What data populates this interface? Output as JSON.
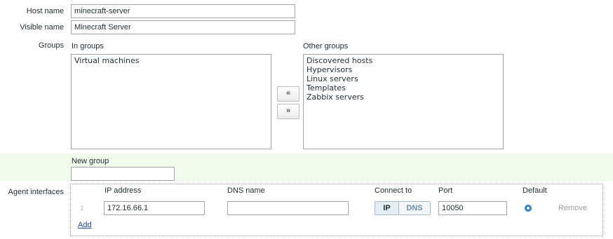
{
  "host": {
    "label": "Host name",
    "value": "minecraft-server"
  },
  "visible": {
    "label": "Visible name",
    "value": "Minecraft Server"
  },
  "groups": {
    "label": "Groups",
    "in_groups_label": "In groups",
    "other_groups_label": "Other groups",
    "in_groups": [
      "Virtual machines"
    ],
    "other_groups": [
      "Discovered hosts",
      "Hypervisors",
      "Linux servers",
      "Templates",
      "Zabbix servers"
    ],
    "move_left": "«",
    "move_right": "»"
  },
  "new_group": {
    "label": "New group",
    "value": ""
  },
  "interfaces": {
    "label": "Agent interfaces",
    "col_ip": "IP address",
    "col_dns": "DNS name",
    "col_connect": "Connect to",
    "col_port": "Port",
    "col_default": "Default",
    "drag_handle": "↕",
    "row": {
      "ip": "172.16.66.1",
      "dns": "",
      "connect_ip": "IP",
      "connect_dns": "DNS",
      "connect_selected": "IP",
      "port": "10050",
      "default_selected": true,
      "remove_label": "Remove"
    },
    "add_label": "Add"
  },
  "colors": {
    "new_group_band": "#f0fbeb",
    "link": "#1a4a8c",
    "radio": "#2a80d6"
  }
}
